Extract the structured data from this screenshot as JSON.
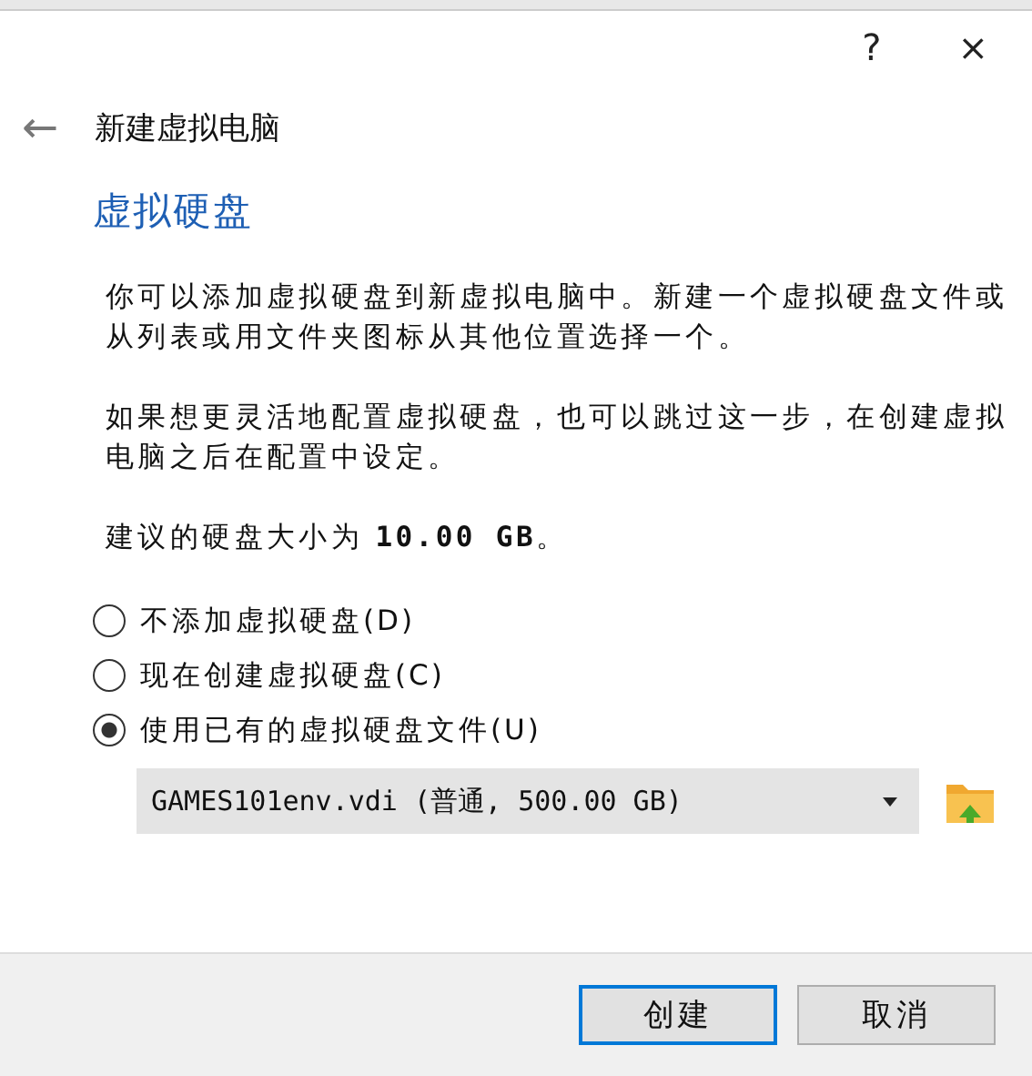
{
  "window": {
    "help": "?",
    "close": "×"
  },
  "header": {
    "back": "←",
    "title": "新建虚拟电脑"
  },
  "heading": "虚拟硬盘",
  "paragraphs": [
    "你可以添加虚拟硬盘到新虚拟电脑中。新建一个虚拟硬盘文件或从列表或用文件夹图标从其他位置选择一个。",
    "如果想更灵活地配置虚拟硬盘，也可以跳过这一步，在创建虚拟电脑之后在配置中设定。",
    "建议的硬盘大小为 **10.00 GB**。"
  ],
  "options": [
    {
      "label": "不添加虚拟硬盘(D)",
      "selected": false
    },
    {
      "label": "现在创建虚拟硬盘(C)",
      "selected": false
    },
    {
      "label": "使用已有的虚拟硬盘文件(U)",
      "selected": true
    }
  ],
  "disk_select": {
    "value": "GAMES101env.vdi (普通, 500.00 GB)"
  },
  "buttons": [
    {
      "label": "创建",
      "default": true
    },
    {
      "label": "取消",
      "default": false
    }
  ]
}
